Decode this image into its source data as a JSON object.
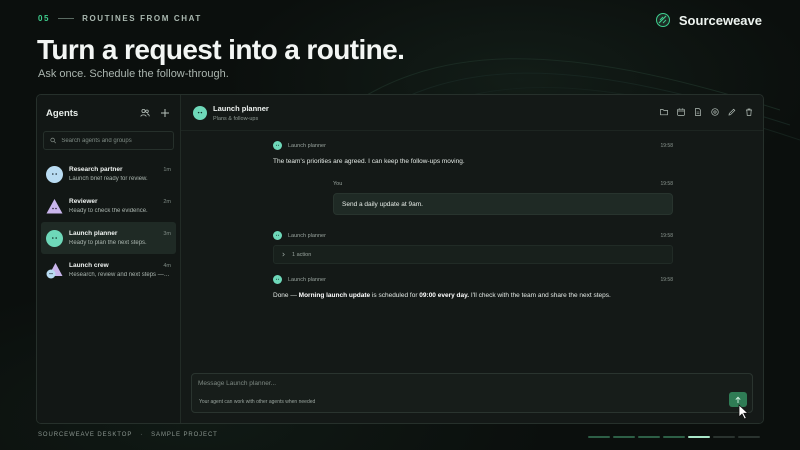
{
  "header": {
    "step_number": "05",
    "kicker": "ROUTINES FROM CHAT",
    "brand": "Sourceweave",
    "title": "Turn a request into a routine.",
    "subtitle": "Ask once. Schedule the follow-through."
  },
  "sidebar": {
    "title": "Agents",
    "search_placeholder": "Search agents and groups",
    "agents": [
      {
        "name": "Research partner",
        "time": "1m",
        "snippet": "Launch brief ready for review.",
        "shape": "circle",
        "color": "#b9dcf2"
      },
      {
        "name": "Reviewer",
        "time": "2m",
        "snippet": "Ready to check the evidence.",
        "shape": "triangle",
        "color": "#c9b5ec"
      },
      {
        "name": "Launch planner",
        "time": "3m",
        "snippet": "Ready to plan the next steps.",
        "shape": "circle",
        "color": "#6ed8b9",
        "active": true
      },
      {
        "name": "Launch crew",
        "time": "4m",
        "snippet": "Research, review and next steps — t…",
        "shape": "group",
        "color": "#c9b5ec"
      }
    ]
  },
  "chat": {
    "title": "Launch planner",
    "subtitle": "Plans & follow-ups",
    "messages": {
      "m1": {
        "author": "Launch planner",
        "time": "19:58",
        "text": "The team's priorities are agreed. I can keep the follow-ups moving."
      },
      "m2": {
        "author": "You",
        "time": "19:58",
        "text": "Send a daily update at 9am."
      },
      "m3": {
        "author": "Launch planner",
        "time": "19:58",
        "action": "1 action"
      },
      "m4": {
        "author": "Launch planner",
        "time": "19:58",
        "text_pre": "Done — ",
        "text_bold1": "Morning launch update",
        "text_mid": " is scheduled for ",
        "text_bold2": "09:00 every day.",
        "text_post": " I'll check with the team and share the next steps."
      }
    },
    "composer": {
      "placeholder": "Message Launch planner...",
      "hint": "Your agent can work with other agents when needed"
    }
  },
  "footer": {
    "app": "SOURCEWEAVE DESKTOP",
    "separator": "·",
    "project": "SAMPLE PROJECT"
  },
  "progress": {
    "total": 7,
    "current": 5
  },
  "colors": {
    "accent": "#3ecf8e",
    "background": "#0b0f0d",
    "send_button": "#2f7c55"
  }
}
